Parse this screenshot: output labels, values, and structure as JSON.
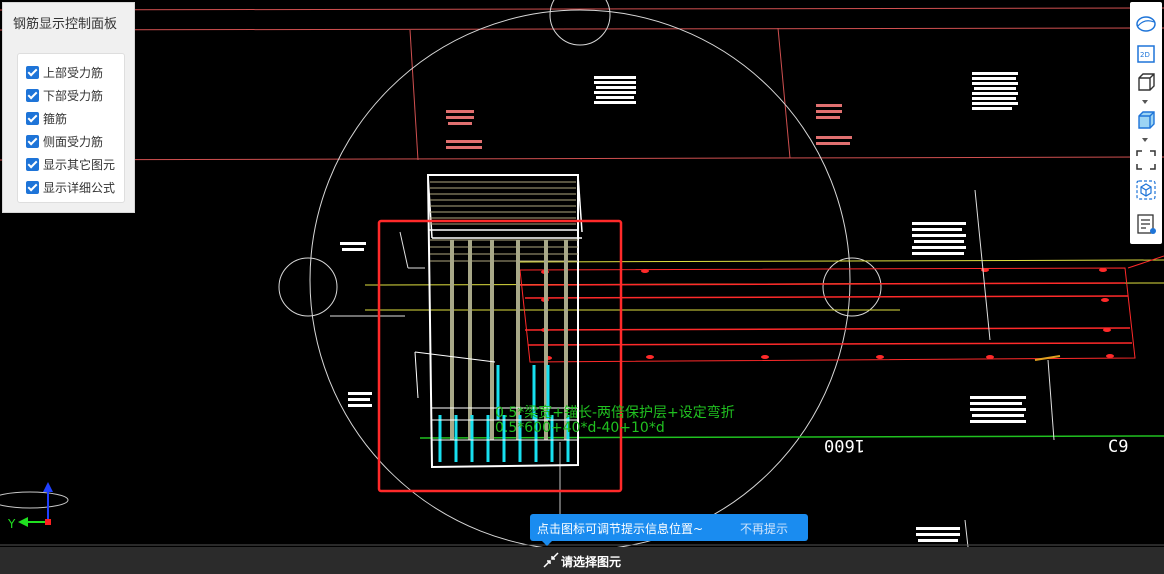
{
  "panel": {
    "title": "钢筋显示控制面板",
    "options": [
      {
        "label": "上部受力筋",
        "checked": true
      },
      {
        "label": "下部受力筋",
        "checked": true
      },
      {
        "label": "箍筋",
        "checked": true
      },
      {
        "label": "侧面受力筋",
        "checked": true
      },
      {
        "label": "显示其它图元",
        "checked": true
      },
      {
        "label": "显示详细公式",
        "checked": true
      }
    ]
  },
  "toolbar": {
    "items": [
      "view-3d-icon",
      "view-2d-icon",
      "wireframe-cube-icon",
      "shaded-cube-icon",
      "fullscreen-icon",
      "component-icon",
      "info-list-icon"
    ]
  },
  "canvas": {
    "formula_text_1": "0.5*梁宽+锚长-两倍保护层+设定弯折",
    "formula_text_2": "0.5*600+40*d-40+10*d",
    "dim_text": "1600",
    "dim_text_right": "C9",
    "axis_y_label": "Y",
    "colors": {
      "background": "#000000",
      "grid_line": "#d05050",
      "rebar_red": "#ff2a2a",
      "rebar_yellow": "#e0e040",
      "rebar_green": "#20c020",
      "stirrup_cyan": "#17e0f0",
      "selection_box": "#ff2a2a",
      "formula_text": "#20c020"
    }
  },
  "hint": {
    "message": "点击图标可调节提示信息位置~",
    "dismiss": "不再提示"
  },
  "status": {
    "text": "请选择图元"
  }
}
